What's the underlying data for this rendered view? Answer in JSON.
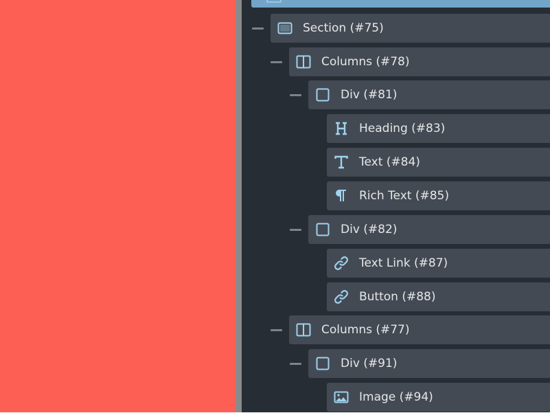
{
  "colors": {
    "canvas": "#fe5f55",
    "divider": "#8a8a8a",
    "panel": "#262d35",
    "row": "#444a53",
    "selected": "#72a5c9",
    "icon": "#9fd3ef",
    "text": "#e6e7e9"
  },
  "tree": {
    "items": [
      {
        "label": "Section (#75)",
        "icon": "section-icon"
      },
      {
        "label": "Columns (#78)",
        "icon": "columns-icon"
      },
      {
        "label": "Div (#81)",
        "icon": "div-icon"
      },
      {
        "label": "Heading (#83)",
        "icon": "heading-icon"
      },
      {
        "label": "Text (#84)",
        "icon": "text-icon"
      },
      {
        "label": "Rich Text (#85)",
        "icon": "rich-text-icon"
      },
      {
        "label": "Div (#82)",
        "icon": "div-icon"
      },
      {
        "label": "Text Link (#87)",
        "icon": "link-icon"
      },
      {
        "label": "Button (#88)",
        "icon": "link-icon"
      },
      {
        "label": "Columns (#77)",
        "icon": "columns-icon"
      },
      {
        "label": "Div (#91)",
        "icon": "div-icon"
      },
      {
        "label": "Image (#94)",
        "icon": "image-icon"
      }
    ]
  }
}
